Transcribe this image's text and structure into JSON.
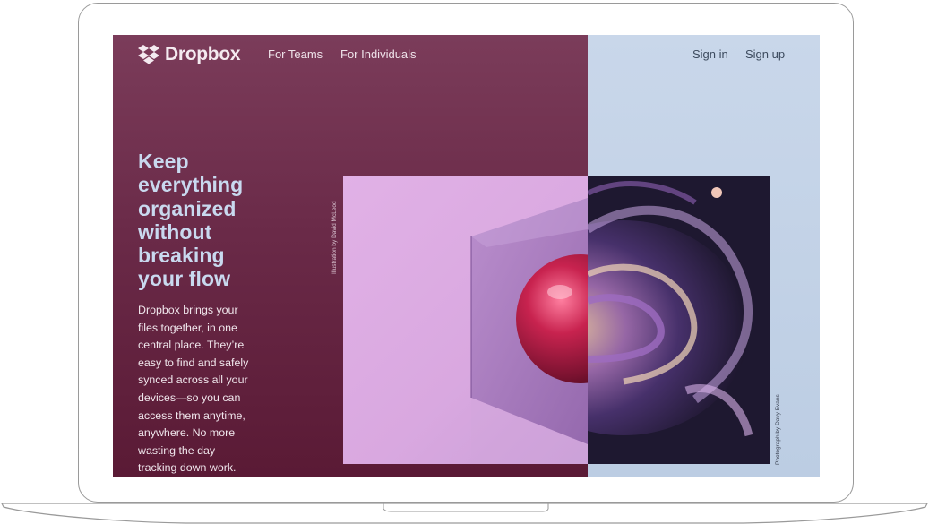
{
  "nav": {
    "brand": "Dropbox",
    "for_teams": "For Teams",
    "for_individuals": "For Individuals",
    "sign_in": "Sign in",
    "sign_up": "Sign up"
  },
  "hero": {
    "headline_lines": [
      "Keep",
      "everything",
      "organized",
      "without",
      "breaking",
      "your flow"
    ],
    "body_lines": [
      "Dropbox brings your",
      "files together, in one",
      "central place. They’re",
      "easy to find and safely",
      "synced across all your",
      "devices—so you can",
      "access them anytime,",
      "anywhere. No more",
      "wasting the day",
      "tracking down work."
    ]
  },
  "credits": {
    "illustration": "Illustration by David McLeod",
    "photograph": "Photograph by Davy Evans"
  },
  "colors": {
    "left_background": "#6a2a48",
    "right_background": "#c0d0e6",
    "headline": "#c9d9ef",
    "art_pink": "#dcaae2"
  }
}
